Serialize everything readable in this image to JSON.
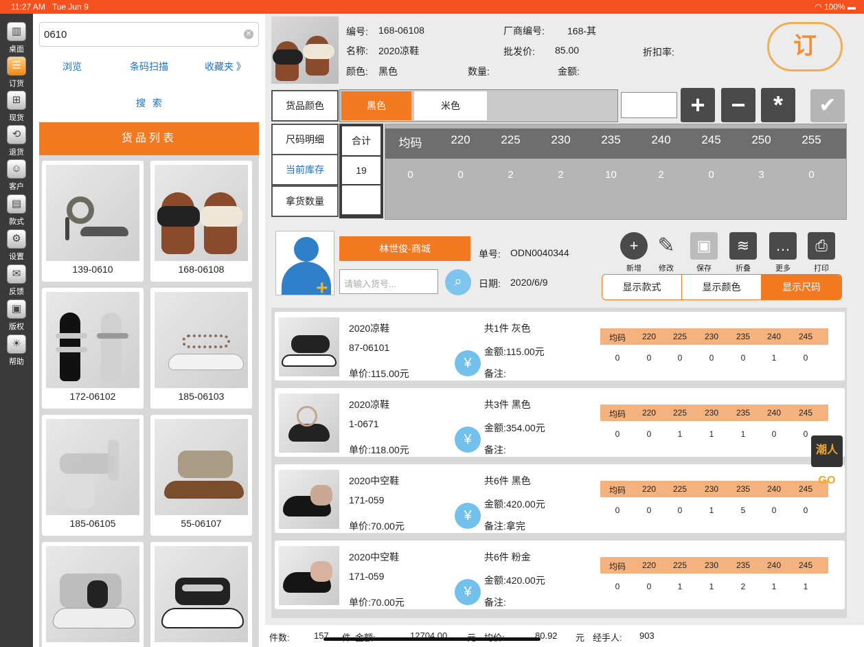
{
  "status_bar": {
    "time": "11:27 AM",
    "date": "Tue Jun 9",
    "battery": "100%",
    "wifi_icon": "wifi-icon",
    "battery_icon": "battery-icon"
  },
  "rail": [
    {
      "label": "桌面",
      "icon": "bank-icon",
      "glyph": "▥"
    },
    {
      "label": "订货",
      "icon": "order-icon",
      "glyph": "☰"
    },
    {
      "label": "现货",
      "icon": "basket-icon",
      "glyph": "⊞"
    },
    {
      "label": "退货",
      "icon": "return-icon",
      "glyph": "⟲"
    },
    {
      "label": "客户",
      "icon": "users-icon",
      "glyph": "☺"
    },
    {
      "label": "款式",
      "icon": "style-icon",
      "glyph": "▤"
    },
    {
      "label": "设置",
      "icon": "settings-icon",
      "glyph": "⚙"
    },
    {
      "label": "反馈",
      "icon": "mail-icon",
      "glyph": "✉"
    },
    {
      "label": "版权",
      "icon": "copyright-icon",
      "glyph": "▣"
    },
    {
      "label": "帮助",
      "icon": "help-icon",
      "glyph": "☀"
    }
  ],
  "left": {
    "search_value": "0610",
    "links": {
      "browse": "浏览",
      "barcode": "条码扫描",
      "favorites": "收藏夹 》"
    },
    "search_button": "搜 索",
    "list_title": "货品列表",
    "products": [
      "139-0610",
      "168-06108",
      "172-06102",
      "185-06103",
      "185-06105",
      "55-06107",
      "",
      ""
    ]
  },
  "info": {
    "number_label": "编号:",
    "number": "168-06108",
    "vendor_label": "厂商编号:",
    "vendor": "168-其",
    "name_label": "名称:",
    "name": "2020凉鞋",
    "wholesale_label": "批发价:",
    "wholesale": "85.00",
    "discount_label": "折扣率:",
    "color_label": "颜色:",
    "color": "黑色",
    "qty_label": "数量:",
    "amount_label": "金额:",
    "stamp": "订"
  },
  "color_row": {
    "label": "货品颜色",
    "colors": [
      "黑色",
      "米色"
    ]
  },
  "size_section": {
    "size_detail": "尺码明细",
    "stock": "当前库存",
    "take_qty": "拿货数量",
    "total_label": "合计",
    "total_stock": "19",
    "sizes": [
      "均码",
      "220",
      "225",
      "230",
      "235",
      "240",
      "245",
      "250",
      "255"
    ],
    "stock_values": [
      "0",
      "0",
      "2",
      "2",
      "10",
      "2",
      "0",
      "3",
      "0"
    ]
  },
  "customer": {
    "name": "林世俊-商城",
    "code_placeholder": "请输入货号...",
    "order_label": "单号:",
    "order_no": "ODN0040344",
    "date_label": "日期:",
    "date": "2020/6/9"
  },
  "actions": [
    "新增",
    "修改",
    "保存",
    "折叠",
    "更多",
    "打印"
  ],
  "display_tabs": [
    "显示款式",
    "显示颜色",
    "显示尺码"
  ],
  "orders": [
    {
      "name": "2020凉鞋",
      "code": "87-06101",
      "price": "单价:115.00元",
      "count": "共1件 灰色",
      "amount": "金额:115.00元",
      "note": "备注:",
      "values": [
        "0",
        "0",
        "0",
        "0",
        "0",
        "1",
        "0"
      ]
    },
    {
      "name": "2020凉鞋",
      "code": "1-0671",
      "price": "单价:118.00元",
      "count": "共3件 黑色",
      "amount": "金额:354.00元",
      "note": "备注:",
      "values": [
        "0",
        "0",
        "1",
        "1",
        "1",
        "0",
        "0"
      ]
    },
    {
      "name": "2020中空鞋",
      "code": "171-059",
      "price": "单价:70.00元",
      "count": "共6件 黑色",
      "amount": "金额:420.00元",
      "note": "备注:拿完",
      "values": [
        "0",
        "0",
        "0",
        "1",
        "5",
        "0",
        "0"
      ]
    },
    {
      "name": "2020中空鞋",
      "code": "171-059",
      "price": "单价:70.00元",
      "count": "共6件 粉金",
      "amount": "金额:420.00元",
      "note": "备注:",
      "values": [
        "0",
        "0",
        "1",
        "1",
        "2",
        "1",
        "1"
      ]
    }
  ],
  "order_sizes": [
    "均码",
    "220",
    "225",
    "230",
    "235",
    "240",
    "245"
  ],
  "badge": "潮人GO",
  "footer": {
    "pieces_label": "件数:",
    "pieces": "157",
    "pieces_unit": "件",
    "amount_label": "金额:",
    "amount": "12704.00",
    "amount_unit": "元",
    "avg_label": "均价:",
    "avg": "80.92",
    "avg_unit": "元",
    "handler_label": "经手人:",
    "handler": "903"
  },
  "colors": {
    "accent": "#f47a22",
    "statusbar": "#f4511e",
    "link": "#1a73c8"
  }
}
